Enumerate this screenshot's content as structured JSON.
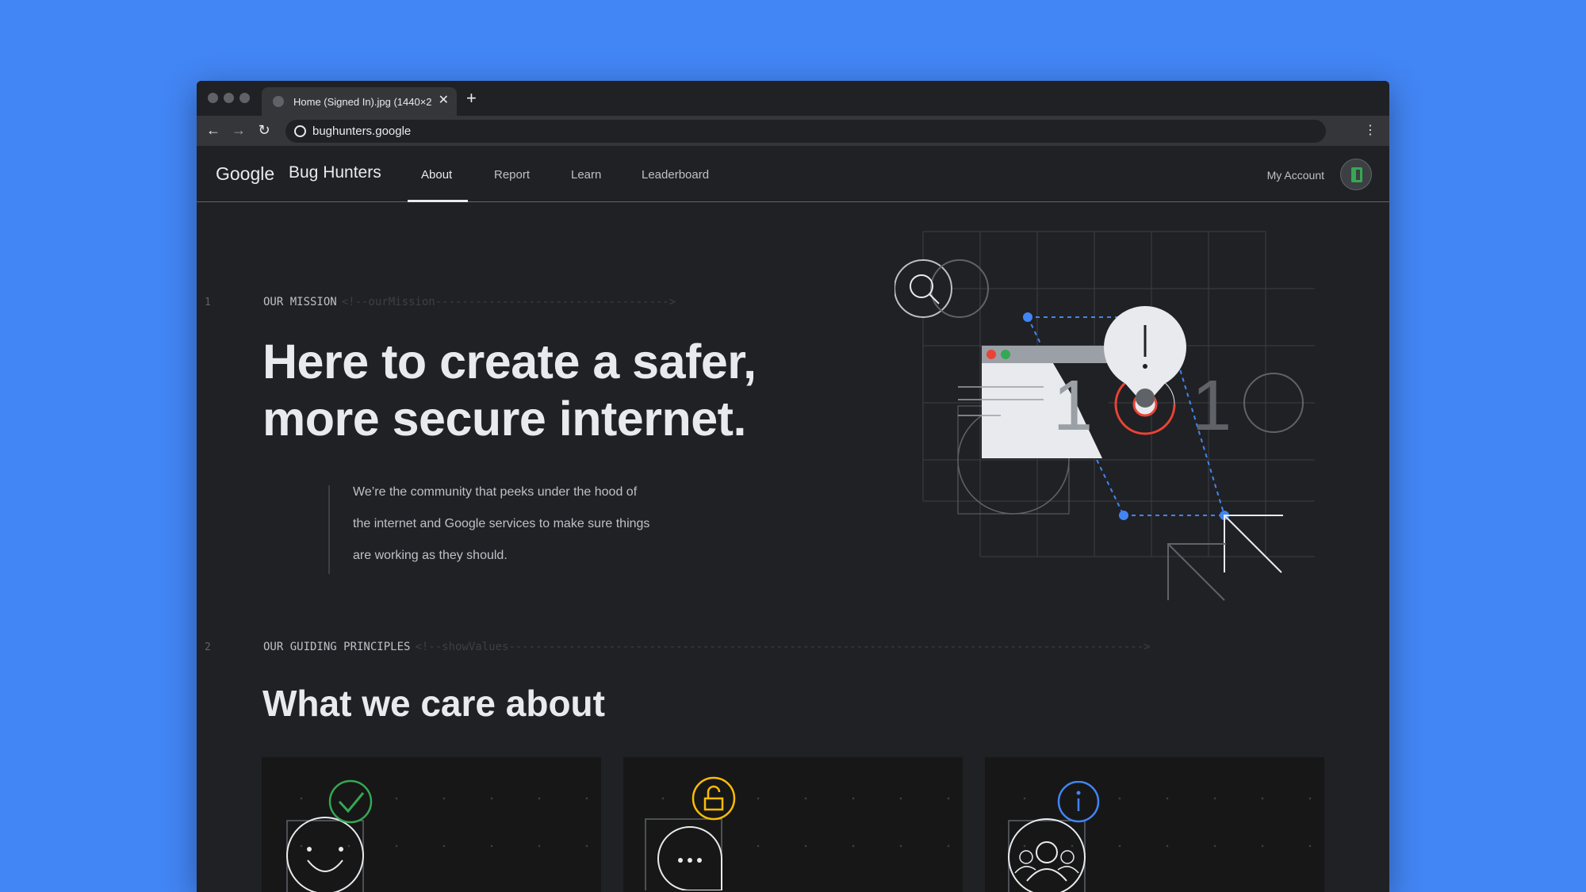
{
  "browser": {
    "tab_title": "Home (Signed In).jpg (1440×2",
    "url": "bughunters.google"
  },
  "site": {
    "logo_google": "Google",
    "logo_product": "Bug Hunters",
    "nav": [
      {
        "label": "About",
        "active": true
      },
      {
        "label": "Report",
        "active": false
      },
      {
        "label": "Learn",
        "active": false
      },
      {
        "label": "Leaderboard",
        "active": false
      }
    ],
    "account_label": "My Account"
  },
  "mission": {
    "line_number": "1",
    "label": "OUR MISSION",
    "comment": "<!--ourMission----------------------------------->",
    "title_line1": "Here to create a safer,",
    "title_line2": "more secure internet.",
    "description_line1": "We’re the community that peeks under the hood of",
    "description_line2": "the internet and Google services to make sure things",
    "description_line3": "are working as they should."
  },
  "principles": {
    "line_number": "2",
    "label": "OUR GUIDING PRINCIPLES",
    "comment": "<!--showValues----------------------------------------------------------------------------------------------->",
    "title": "What we care about"
  },
  "icons": {
    "card1": "smile-check-icon",
    "card2": "chat-lock-icon",
    "card3": "people-info-icon"
  },
  "colors": {
    "page_background": "#4285f4",
    "site_background": "#202124",
    "accent_blue": "#4285f4",
    "accent_green": "#34a853",
    "accent_yellow": "#fbbc04",
    "accent_red": "#ea4335"
  }
}
